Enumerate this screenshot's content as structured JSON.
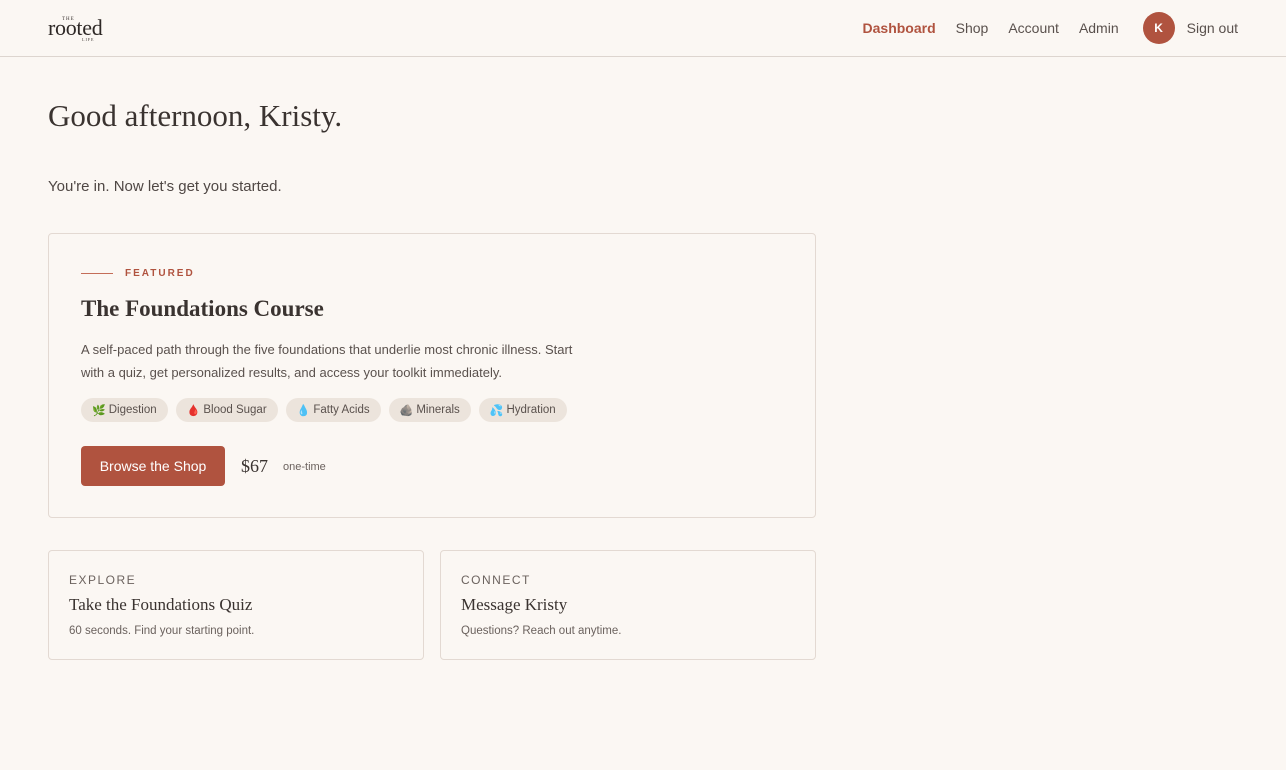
{
  "header": {
    "logo": {
      "the": "THE",
      "word": "rooted",
      "life": "LIFE"
    },
    "nav": [
      {
        "label": "Dashboard",
        "active": true
      },
      {
        "label": "Shop",
        "active": false
      },
      {
        "label": "Account",
        "active": false
      },
      {
        "label": "Admin",
        "active": false
      }
    ],
    "avatar_initial": "K",
    "sign_out": "Sign out"
  },
  "greeting": "Good afternoon, Kristy.",
  "subtitle": "You're in. Now let's get you started.",
  "featured": {
    "eyebrow": "FEATURED",
    "title": "The Foundations Course",
    "description": "A self-paced path through the five foundations that underlie most chronic illness. Start with a quiz, get personalized results, and access your toolkit immediately.",
    "tags": [
      {
        "icon": "🌿",
        "icon_name": "herb-icon",
        "label": "Digestion"
      },
      {
        "icon": "🩸",
        "icon_name": "blood-drop-icon",
        "label": "Blood Sugar"
      },
      {
        "icon": "💧",
        "icon_name": "water-drop-icon",
        "label": "Fatty Acids"
      },
      {
        "icon": "🪨",
        "icon_name": "rock-icon",
        "label": "Minerals"
      },
      {
        "icon": "💦",
        "icon_name": "splash-icon",
        "label": "Hydration"
      }
    ],
    "cta_label": "Browse the Shop",
    "price": "$67",
    "price_note": "one-time"
  },
  "cards": [
    {
      "label": "EXPLORE",
      "title": "Take the Foundations Quiz",
      "description": "60 seconds. Find your starting point."
    },
    {
      "label": "CONNECT",
      "title": "Message Kristy",
      "description": "Questions? Reach out anytime."
    }
  ],
  "colors": {
    "accent": "#b0533f",
    "background": "#fbf7f3",
    "tag_bg": "#ece4dc",
    "border": "#e3d9d2"
  }
}
